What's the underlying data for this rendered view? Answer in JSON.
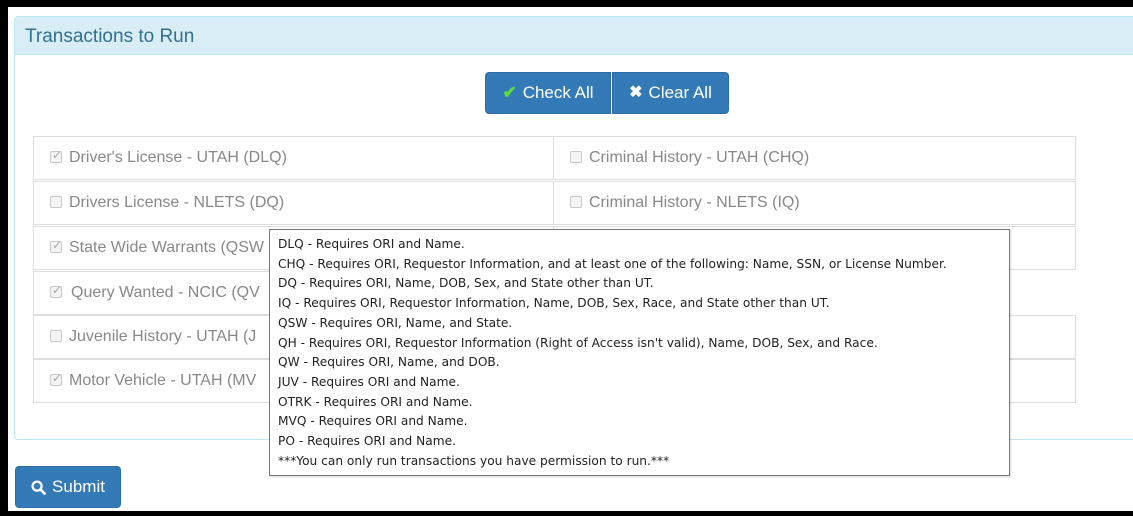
{
  "panel": {
    "title": "Transactions to Run"
  },
  "toolbar": {
    "check_all_label": "Check All",
    "clear_all_label": "Clear All"
  },
  "transactions": {
    "dlq": {
      "label": "Driver's License - UTAH (DLQ)",
      "checked": true
    },
    "chq": {
      "label": "Criminal History - UTAH (CHQ)",
      "checked": false
    },
    "dq": {
      "label": "Drivers License - NLETS (DQ)",
      "checked": false
    },
    "iq": {
      "label": "Criminal History - NLETS (IQ)",
      "checked": false
    },
    "qsw": {
      "label": "State Wide Warrants (QSW",
      "checked": true
    },
    "qw": {
      "label": "Query Wanted - NCIC (QV",
      "checked": true
    },
    "juv": {
      "label": "Juvenile History - UTAH (J",
      "checked": false
    },
    "mvq": {
      "label": "Motor Vehicle - UTAH (MV",
      "checked": true
    }
  },
  "tooltip": {
    "lines": [
      "DLQ - Requires ORI and Name.",
      "CHQ - Requires ORI, Requestor Information, and at least one of the following: Name, SSN, or License Number.",
      "DQ - Requires ORI, Name, DOB, Sex, and State other than UT.",
      "IQ - Requires ORI, Requestor Information, Name, DOB, Sex, Race, and State other than UT.",
      "QSW - Requires ORI, Name, and State.",
      "QH - Requires ORI, Requestor Information (Right of Access isn't valid), Name, DOB, Sex, and Race.",
      "QW - Requires ORI, Name, and DOB.",
      "JUV - Requires ORI and Name.",
      "OTRK - Requires ORI and Name.",
      "MVQ - Requires ORI and Name.",
      "PO - Requires ORI and Name.",
      "***You can only run transactions you have permission to run.***"
    ]
  },
  "submit": {
    "label": "Submit"
  },
  "colors": {
    "primary": "#337ab7",
    "heading_bg": "#d9edf7",
    "heading_text": "#31708f",
    "check_icon": "#5cdc3c"
  }
}
